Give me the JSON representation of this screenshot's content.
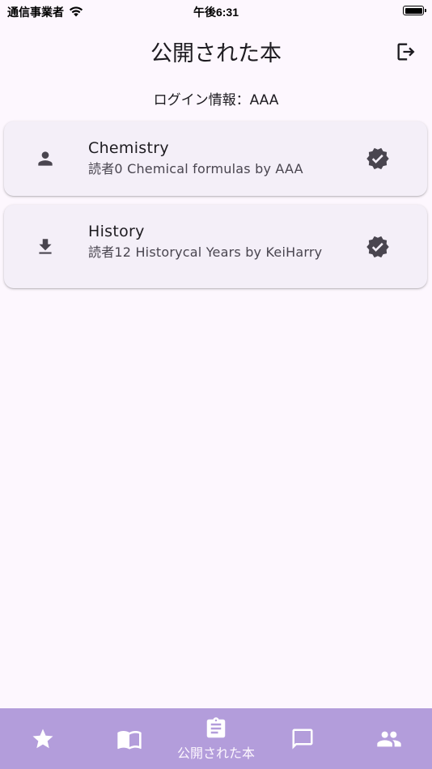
{
  "status_bar": {
    "carrier": "通信事業者",
    "time": "午後6:31"
  },
  "app_bar": {
    "title": "公開された本",
    "logout_icon": "logout-icon"
  },
  "login_info": "ログイン情報：AAA",
  "books": [
    {
      "title": "Chemistry",
      "subtitle": "読者0 Chemical formulas by AAA",
      "leading_icon": "person-icon",
      "trailing_icon": "verified-icon"
    },
    {
      "title": "History",
      "subtitle": "読者12 Historycal Years by KeiHarry",
      "leading_icon": "download-icon",
      "trailing_icon": "verified-icon"
    }
  ],
  "bottom_nav": {
    "items": [
      {
        "icon": "star-icon",
        "label": ""
      },
      {
        "icon": "book-open-icon",
        "label": ""
      },
      {
        "icon": "assignment-icon",
        "label": "公開された本",
        "selected": true
      },
      {
        "icon": "chat-icon",
        "label": ""
      },
      {
        "icon": "people-icon",
        "label": ""
      }
    ]
  },
  "colors": {
    "background": "#fdf7fe",
    "card": "#f4eff8",
    "nav_bar": "#b39ddb",
    "icon": "#49454f",
    "nav_icon": "#ffffff"
  }
}
